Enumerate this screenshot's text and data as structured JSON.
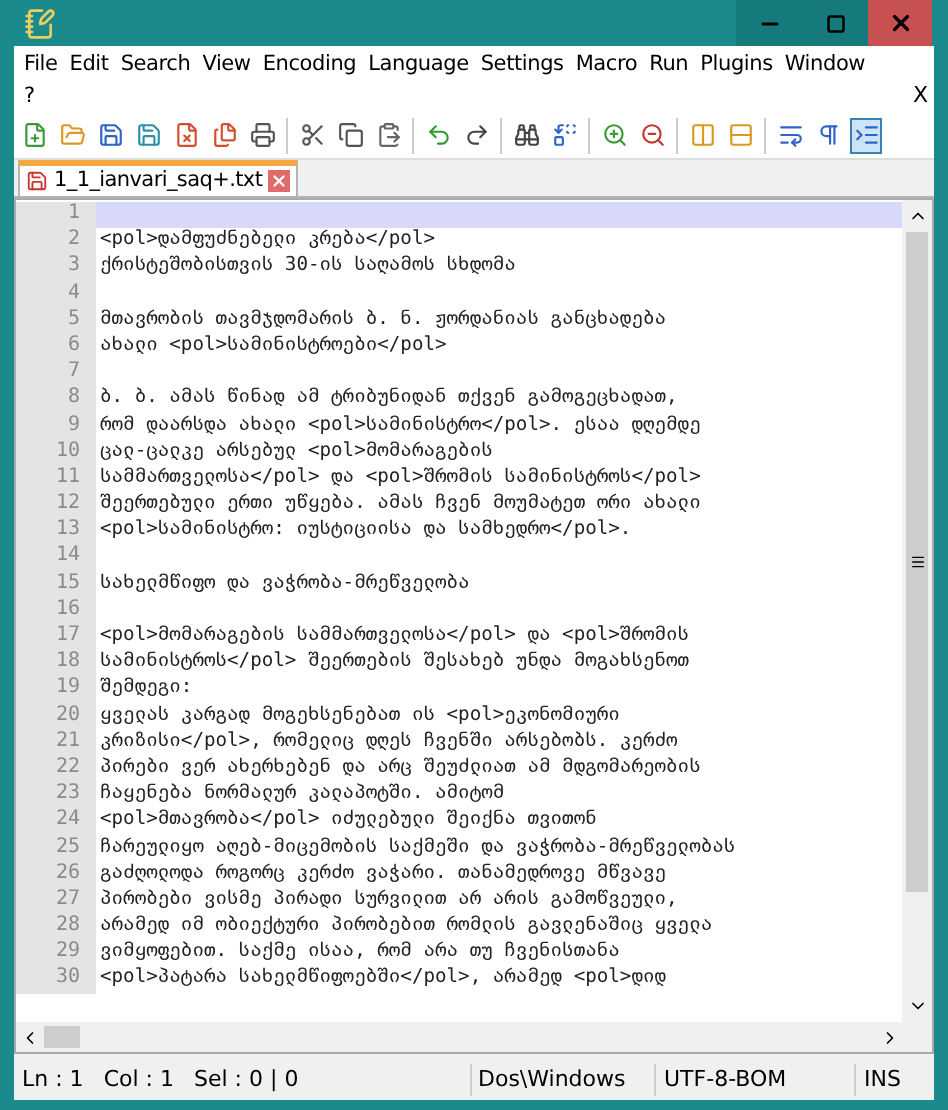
{
  "menu": [
    [
      {
        "label": "File"
      },
      {
        "label": "Edit"
      },
      {
        "label": "Search"
      },
      {
        "label": "View"
      },
      {
        "label": "Encoding"
      },
      {
        "label": "Language"
      },
      {
        "label": "Settings"
      },
      {
        "label": "Macro"
      },
      {
        "label": "Run"
      },
      {
        "label": "Plugins"
      },
      {
        "label": "Window"
      }
    ],
    [
      {
        "label": "?"
      }
    ]
  ],
  "menu_close": "X",
  "toolbar": [
    {
      "kind": "new",
      "pressed": false
    },
    {
      "kind": "open",
      "pressed": false
    },
    {
      "kind": "save",
      "pressed": false
    },
    {
      "kind": "saveall",
      "pressed": false
    },
    {
      "kind": "close",
      "pressed": false
    },
    {
      "kind": "closeall",
      "pressed": false
    },
    {
      "kind": "print",
      "pressed": false
    },
    {
      "kind": "sep"
    },
    {
      "kind": "cut",
      "pressed": false
    },
    {
      "kind": "copy",
      "pressed": false
    },
    {
      "kind": "paste",
      "pressed": false
    },
    {
      "kind": "sep"
    },
    {
      "kind": "undo",
      "pressed": false
    },
    {
      "kind": "redo",
      "pressed": false
    },
    {
      "kind": "sep"
    },
    {
      "kind": "find",
      "pressed": false
    },
    {
      "kind": "replace",
      "pressed": false
    },
    {
      "kind": "sep"
    },
    {
      "kind": "zoomin",
      "pressed": false
    },
    {
      "kind": "zoomout",
      "pressed": false
    },
    {
      "kind": "sep"
    },
    {
      "kind": "syncv",
      "pressed": false
    },
    {
      "kind": "synch",
      "pressed": false
    },
    {
      "kind": "sep"
    },
    {
      "kind": "wrap",
      "pressed": false
    },
    {
      "kind": "pilcrow",
      "pressed": false
    },
    {
      "kind": "indent",
      "pressed": true
    }
  ],
  "tabs": [
    {
      "label": "1_1_ianvari_saq+.txt",
      "selected": true,
      "modified": true
    }
  ],
  "lines": [
    {
      "number": "1",
      "current": true
    },
    {
      "number": "2",
      "text": "<pol>დამფუძნებელი კრება</pol>",
      "current": false
    },
    {
      "number": "3",
      "text": "ქრისტეშობისთვის 30-ის საღამოს სხდომა",
      "current": false
    },
    {
      "number": "4",
      "current": false
    },
    {
      "number": "5",
      "text": "მთავრობის თავმჯდომარის ბ. ნ. ჟორდანიას განცხადება",
      "current": false
    },
    {
      "number": "6",
      "text": "ახალი <pol>სამინისტროები</pol>",
      "current": false
    },
    {
      "number": "7",
      "current": false
    },
    {
      "number": "8",
      "text": "ბ. ბ. ამას წინად ამ ტრიბუნიდან თქვენ გამოგეცხადათ,",
      "current": false
    },
    {
      "number": "9",
      "text": "რომ დაარსდა ახალი <pol>სამინისტრო</pol>. ესაა დღემდე",
      "current": false
    },
    {
      "number": "10",
      "text": "ცალ-ცალკე არსებულ <pol>მომარაგების",
      "current": false
    },
    {
      "number": "11",
      "text": "სამმართველოსა</pol> და <pol>შრომის სამინისტროს</pol>",
      "current": false
    },
    {
      "number": "12",
      "text": "შეერთებული ერთი უწყება. ამას ჩვენ მოუმატეთ ორი ახალი",
      "current": false
    },
    {
      "number": "13",
      "text": "<pol>სამინისტრო: იუსტიციისა და სამხედრო</pol>.",
      "current": false
    },
    {
      "number": "14",
      "current": false
    },
    {
      "number": "15",
      "text": "სახელმწიფო და ვაჭრობა-მრეწველობა",
      "current": false
    },
    {
      "number": "16",
      "current": false
    },
    {
      "number": "17",
      "text": "<pol>მომარაგების სამმართველოსა</pol> და <pol>შრომის",
      "current": false
    },
    {
      "number": "18",
      "text": "სამინისტროს</pol> შეერთების შესახებ უნდა მოგახსენოთ",
      "current": false
    },
    {
      "number": "19",
      "text": "შემდეგი:",
      "current": false
    },
    {
      "number": "20",
      "text": "ყველას კარგად მოგეხსენებათ ის <pol>ეკონომიური",
      "current": false
    },
    {
      "number": "21",
      "text": "კრიზისი</pol>, რომელიც დღეს ჩვენში არსებობს. კერძო",
      "current": false
    },
    {
      "number": "22",
      "text": "პირები ვერ ახერხებენ და არც შეუძლიათ ამ მდგომარეობის",
      "current": false
    },
    {
      "number": "23",
      "text": "ჩაყენება ნორმალურ კალაპოტში. ამიტომ",
      "current": false
    },
    {
      "number": "24",
      "text": "<pol>მთავრობა</pol> იძულებული შეიქნა თვითონ",
      "current": false
    },
    {
      "number": "25",
      "text": "ჩარეულიყო აღებ-მიცემობის საქმეში და ვაჭრობა-მრეწველობას",
      "current": false
    },
    {
      "number": "26",
      "text": "გაძღოლოდა როგორც კერძო ვაჭარი. თანამედროვე მწვავე",
      "current": false
    },
    {
      "number": "27",
      "text": "პირობები ვისმე პირადი სურვილით არ არის გამოწვეული,",
      "current": false
    },
    {
      "number": "28",
      "text": "არამედ იმ ობიექტური პირობებით რომლის გავლენაშიც ყველა",
      "current": false
    },
    {
      "number": "29",
      "text": "ვიმყოფებით. საქმე ისაა, რომ არა თუ ჩვენისთანა",
      "current": false
    },
    {
      "number": "30",
      "text": "<pol>პატარა სახელმწიფოებში</pol>, არამედ <pol>დიდ",
      "current": false
    }
  ],
  "status_bar": {
    "position": [
      {
        "text": "Ln : 1"
      },
      {
        "text": "Col : 1"
      },
      {
        "text": "Sel : 0 | 0"
      }
    ],
    "eol": "Dos\\Windows",
    "encoding": "UTF-8-BOM",
    "mode": "INS"
  }
}
